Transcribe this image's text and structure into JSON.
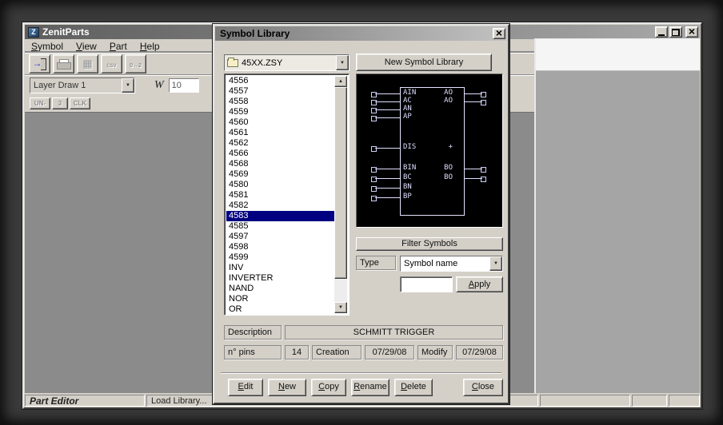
{
  "main_window": {
    "title": "ZenitParts",
    "menu": [
      "Symbol",
      "View",
      "Part",
      "Help"
    ],
    "toolbar_icons": [
      "exit-icon",
      "print-icon",
      "grid-icon",
      "csv-icon",
      "scale-0-2-icon"
    ],
    "window_control_icons": [
      "minimize-icon",
      "restore-icon",
      "close-icon"
    ],
    "layer_combo_value": "Layer Draw 1",
    "width_label": "W",
    "width_value": "10",
    "mini_buttons": [
      "UN-",
      "3",
      "CLK"
    ],
    "status": {
      "mode": "Part Editor",
      "message": "Load Library..."
    }
  },
  "symbol_library_dialog": {
    "title": "Symbol Library",
    "library_combo_value": "45XX.ZSY",
    "library_combo_icon": "folder-icon",
    "new_symbol_library_button": "New Symbol Library",
    "symbols": [
      "4556",
      "4557",
      "4558",
      "4559",
      "4560",
      "4561",
      "4562",
      "4566",
      "4568",
      "4569",
      "4580",
      "4581",
      "4582",
      "4583",
      "4585",
      "4597",
      "4598",
      "4599",
      "INV",
      "INVERTER",
      "NAND",
      "NOR",
      "OR"
    ],
    "selected_symbol": "4583",
    "filter_symbols_label": "Filter Symbols",
    "type_label": "Type",
    "type_combo_value": "Symbol name",
    "filter_value": "",
    "apply_button": "Apply",
    "description_label": "Description",
    "description_value": "SCHMITT TRIGGER",
    "pins_label": "n° pins",
    "pins_value": "14",
    "creation_label": "Creation",
    "creation_value": "07/29/08",
    "modify_label": "Modify",
    "modify_value": "07/29/08",
    "action_buttons": [
      "Edit",
      "New",
      "Copy",
      "Rename",
      "Delete"
    ],
    "close_button": "Close",
    "preview": {
      "colors": {
        "background": "#000000",
        "drawing": "#dedeff",
        "selection": "#000080"
      },
      "left_pin_labels": [
        "AIN",
        "AC",
        "AN",
        "AP",
        "DIS",
        "BIN",
        "BC",
        "BN",
        "BP"
      ],
      "right_pin_labels": [
        "AO",
        "AO",
        "+",
        "BO",
        "BO"
      ]
    }
  }
}
